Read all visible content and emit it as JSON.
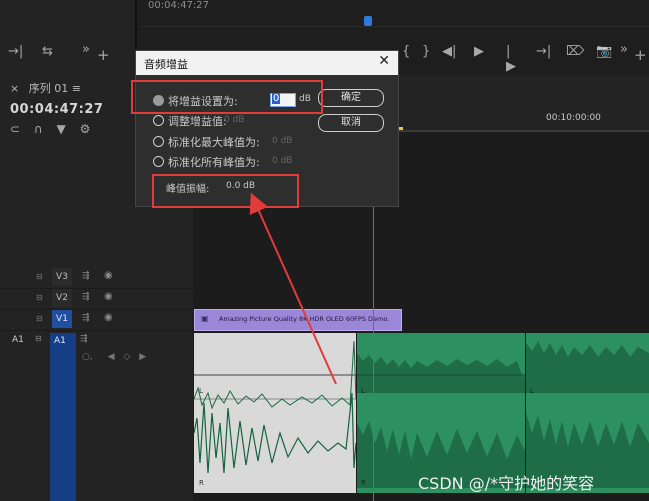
{
  "top": {
    "timecode": "00:04:47:27",
    "left_glyphs": [
      "→|",
      "⇆",
      "»",
      "+"
    ],
    "right_glyphs": [
      "{",
      "}",
      "|←",
      "◀|",
      "▶",
      "|▶",
      "→|",
      "⌦",
      "⊡",
      "📷",
      "»",
      "+"
    ]
  },
  "sequence": {
    "tab_label": "序列 01 ≡",
    "close_glyph": "×",
    "timecode": "00:04:47:27",
    "ruler_time": "00:10:00:00"
  },
  "dialog": {
    "title": "音频增益",
    "close": "✕",
    "options": [
      {
        "label": "将增益设置为:",
        "selected": true
      },
      {
        "label": "调整增益值:",
        "value": "0 dB",
        "selected": false
      },
      {
        "label": "标准化最大峰值为:",
        "value": "0 dB",
        "selected": false
      },
      {
        "label": "标准化所有峰值为:",
        "value": "0 dB",
        "selected": false
      }
    ],
    "gain_value": "0",
    "gain_unit": "dB",
    "ok_label": "确定",
    "cancel_label": "取消",
    "peak_label": "峰值振幅:",
    "peak_value": "0.0 dB"
  },
  "tracks": [
    {
      "name": "V3"
    },
    {
      "name": "V2"
    },
    {
      "name": "V1"
    },
    {
      "name": "A1",
      "outer": "A1"
    }
  ],
  "video_clip": {
    "title": "Amazing Picture Quality 8K HDR OLED 60FPS Demo."
  },
  "watermark": "CSDN @/*守护她的笑容",
  "colors": {
    "accent": "#2a7bdc",
    "annotation": "#e23b3b",
    "video_clip": "#9b87d8",
    "audio_clip": "#2c9060"
  }
}
